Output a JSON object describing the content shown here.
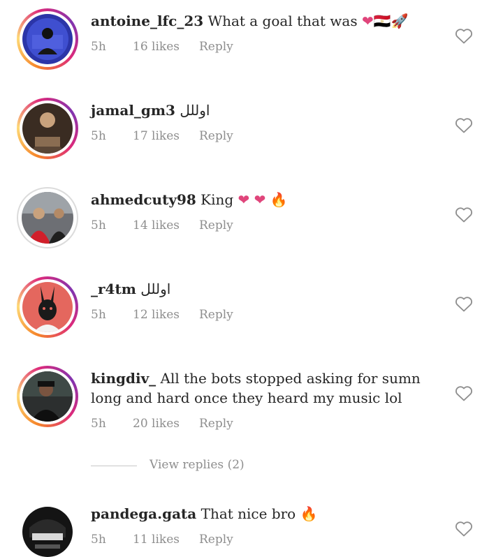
{
  "comments": [
    {
      "username": "antoine_lfc_23",
      "text": "What a goal that was",
      "emoji": "❤🇪🇬🚀",
      "time": "5h",
      "likes": "16 likes",
      "reply": "Reply"
    },
    {
      "username": "jamal_gm3",
      "text": "اوللل",
      "emoji": "",
      "time": "5h",
      "likes": "17 likes",
      "reply": "Reply"
    },
    {
      "username": "ahmedcuty98",
      "text": "King",
      "emoji": "❤ ❤ 🔥",
      "time": "5h",
      "likes": "14 likes",
      "reply": "Reply"
    },
    {
      "username": "_r4tm",
      "text": "اوللل",
      "emoji": "",
      "time": "5h",
      "likes": "12 likes",
      "reply": "Reply"
    },
    {
      "username": "kingdiv_",
      "text": "All the bots stopped asking for sumn long and hard once they heard my music lol",
      "emoji": "",
      "time": "5h",
      "likes": "20 likes",
      "reply": "Reply"
    },
    {
      "username": "pandega.gata",
      "text": "That nice bro",
      "emoji": "🔥",
      "time": "5h",
      "likes": "11 likes",
      "reply": "Reply"
    }
  ],
  "view_replies": "View replies (2)",
  "icons": {
    "like": "heart-outline-icon"
  },
  "colors": {
    "text": "#262626",
    "meta": "#8e8e8e",
    "heart_emoji": "#e0457b"
  }
}
